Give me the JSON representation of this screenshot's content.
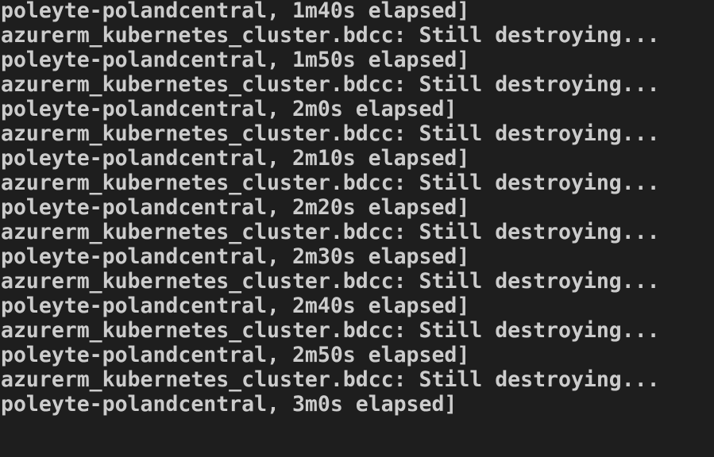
{
  "terminal": {
    "lines": [
      "poleyte-polandcentral, 1m40s elapsed]",
      "azurerm_kubernetes_cluster.bdcc: Still destroying...",
      "poleyte-polandcentral, 1m50s elapsed]",
      "azurerm_kubernetes_cluster.bdcc: Still destroying...",
      "poleyte-polandcentral, 2m0s elapsed]",
      "azurerm_kubernetes_cluster.bdcc: Still destroying...",
      "poleyte-polandcentral, 2m10s elapsed]",
      "azurerm_kubernetes_cluster.bdcc: Still destroying...",
      "poleyte-polandcentral, 2m20s elapsed]",
      "azurerm_kubernetes_cluster.bdcc: Still destroying...",
      "poleyte-polandcentral, 2m30s elapsed]",
      "azurerm_kubernetes_cluster.bdcc: Still destroying...",
      "poleyte-polandcentral, 2m40s elapsed]",
      "azurerm_kubernetes_cluster.bdcc: Still destroying...",
      "poleyte-polandcentral, 2m50s elapsed]",
      "azurerm_kubernetes_cluster.bdcc: Still destroying...",
      "poleyte-polandcentral, 3m0s elapsed]"
    ],
    "colors": {
      "background": "#1e1e1e",
      "text": "#cccccc"
    }
  }
}
